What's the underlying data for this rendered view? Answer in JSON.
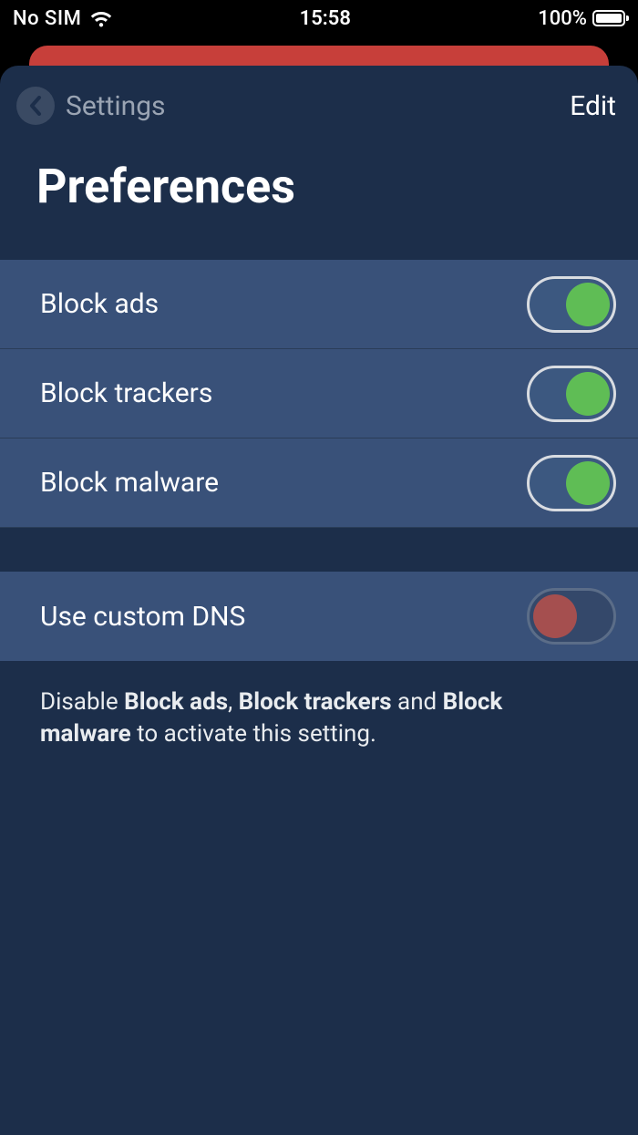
{
  "status_bar": {
    "no_sim_label": "No SIM",
    "time": "15:58",
    "battery_pct": "100%"
  },
  "nav": {
    "back_label": "Settings",
    "edit_label": "Edit"
  },
  "title": "Preferences",
  "rows_group1": [
    {
      "label": "Block ads",
      "on": true
    },
    {
      "label": "Block trackers",
      "on": true
    },
    {
      "label": "Block malware",
      "on": true
    }
  ],
  "rows_group2": [
    {
      "label": "Use custom DNS",
      "on": false
    }
  ],
  "hint": {
    "t0": "Disable ",
    "b0": "Block ads",
    "t1": ", ",
    "b1": "Block trackers",
    "t2": " and ",
    "b2": "Block malware",
    "t3": " to activate this setting."
  },
  "colors": {
    "sheet_bg": "#1c2e4a",
    "row_bg": "#395179",
    "toggle_on_knob": "#5fbd55",
    "toggle_off_knob": "#a54f4f",
    "behind_strip": "#c73f3a"
  }
}
